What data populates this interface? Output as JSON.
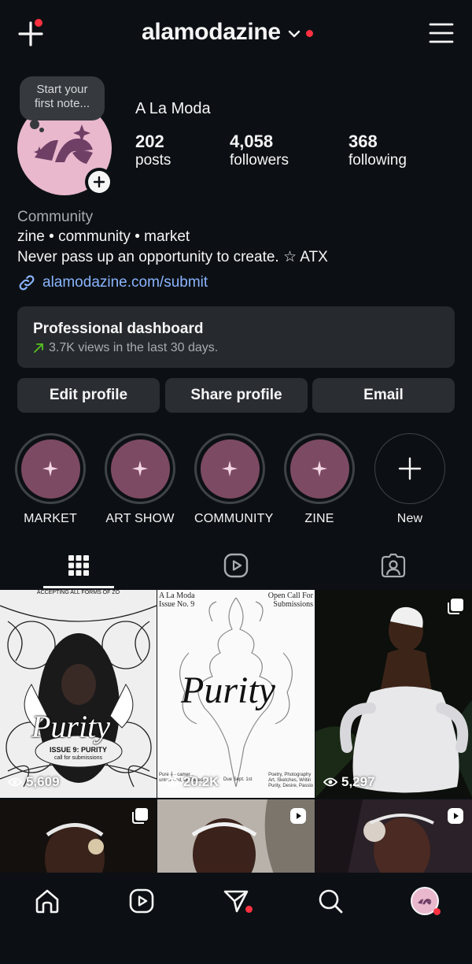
{
  "header": {
    "username": "alamodazine",
    "icons": {
      "create": "plus-icon",
      "switch": "chevron-down-icon",
      "menu": "hamburger-menu-icon"
    }
  },
  "note": {
    "text_line1": "Start your",
    "text_line2": "first note..."
  },
  "profile": {
    "display_name": "A La Moda",
    "stats": [
      {
        "value": "202",
        "label": "posts"
      },
      {
        "value": "4,058",
        "label": "followers"
      },
      {
        "value": "368",
        "label": "following"
      }
    ],
    "category": "Community",
    "bio_line1": "zine • community • market",
    "bio_line2": "Never pass up an opportunity to create. ☆ ATX",
    "link": "alamodazine.com/submit"
  },
  "dashboard": {
    "title": "Professional dashboard",
    "subtitle": "3.7K views in the last 30 days."
  },
  "buttons": {
    "edit": "Edit profile",
    "share": "Share profile",
    "email": "Email"
  },
  "highlights": [
    {
      "label": "MARKET"
    },
    {
      "label": "ART SHOW"
    },
    {
      "label": "COMMUNITY"
    },
    {
      "label": "ZINE"
    },
    {
      "label": "New"
    }
  ],
  "tabs": {
    "active": "grid",
    "icons": [
      "grid-icon",
      "reels-icon",
      "tagged-icon"
    ]
  },
  "posts": [
    {
      "type": "carousel",
      "views": "5,609",
      "text": {
        "top": "ACCEPTING ALL FORMS OF ZO",
        "title": "Purity",
        "issue": "ISSUE 9: PURITY",
        "sub": "call for submissions"
      }
    },
    {
      "type": "image",
      "views": "20.2K",
      "text": {
        "left_top": "A La Moda\nIssue No. 9",
        "right_top": "Open Call For\nSubmissions",
        "title": "Purity",
        "bottom_left": "Pure 𝄞 - camer...\nuntouched, unfiltered",
        "bottom_mid": "Due Sept. 1st",
        "bottom_right": "Poetry, Photography\nArt, Sketches, Writin\nPurity, Desire, Passio"
      }
    },
    {
      "type": "carousel",
      "views": "5,297"
    },
    {
      "type": "carousel"
    },
    {
      "type": "reel"
    },
    {
      "type": "reel"
    }
  ],
  "nav": {
    "items": [
      "home-icon",
      "reels-icon",
      "messages-icon",
      "search-icon",
      "profile-avatar"
    ]
  },
  "colors": {
    "bg": "#0c1014",
    "accent_link": "#8ab4ff",
    "badge_red": "#ff3040",
    "highlight": "#7d4a63",
    "avatar_bg": "#e9b8cd"
  }
}
